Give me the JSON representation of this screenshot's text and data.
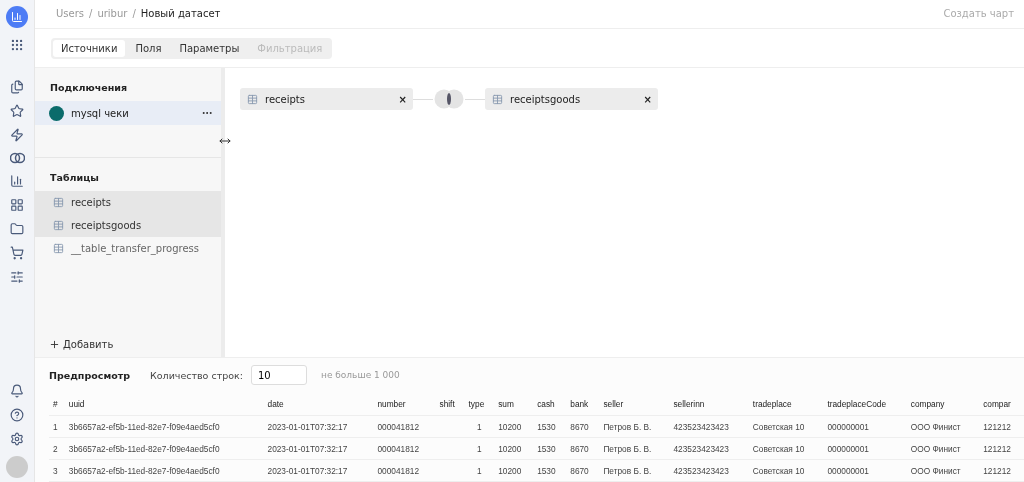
{
  "breadcrumbs": [
    "Users",
    "uribur",
    "Новый датасет"
  ],
  "breadcrumb_separator": "/",
  "header_action": "Создать чарт",
  "tabs": [
    {
      "label": "Источники",
      "selected": true,
      "disabled": false
    },
    {
      "label": "Поля",
      "selected": false,
      "disabled": false
    },
    {
      "label": "Параметры",
      "selected": false,
      "disabled": false
    },
    {
      "label": "Фильтрация",
      "selected": false,
      "disabled": true
    }
  ],
  "connections": {
    "title": "Подключения",
    "items": [
      {
        "label": "mysql чеки",
        "selected": true
      }
    ]
  },
  "tables": {
    "title": "Таблицы",
    "items": [
      {
        "label": "receipts",
        "selected": true
      },
      {
        "label": "receiptsgoods",
        "selected": true
      },
      {
        "label": "__table_transfer_progress",
        "selected": false
      }
    ]
  },
  "add_button": "Добавить",
  "canvas": {
    "sources": [
      {
        "label": "receipts",
        "close": "×"
      },
      {
        "label": "receiptsgoods",
        "close": "×"
      }
    ]
  },
  "preview": {
    "title": "Предпросмотр",
    "rows_label": "Количество строк:",
    "rows_value": "10",
    "rows_hint": "не больше 1 000",
    "columns": [
      "#",
      "uuid",
      "date",
      "number",
      "shift",
      "type",
      "sum",
      "cash",
      "bank",
      "seller",
      "sellerinn",
      "tradeplace",
      "tradeplaceCode",
      "company",
      "compar"
    ],
    "rows": [
      [
        "1",
        "3b6657a2-ef5b-11ed-82e7-f09e4aed5cf0",
        "2023-01-01T07:32:17",
        "000041812",
        "",
        "1",
        "10200",
        "1530",
        "8670",
        "Петров Б. В.",
        "423523423423",
        "Советская 10",
        "000000001",
        "ООО Финист",
        "121212"
      ],
      [
        "2",
        "3b6657a2-ef5b-11ed-82e7-f09e4aed5cf0",
        "2023-01-01T07:32:17",
        "000041812",
        "",
        "1",
        "10200",
        "1530",
        "8670",
        "Петров Б. В.",
        "423523423423",
        "Советская 10",
        "000000001",
        "ООО Финист",
        "121212"
      ],
      [
        "3",
        "3b6657a2-ef5b-11ed-82e7-f09e4aed5cf0",
        "2023-01-01T07:32:17",
        "000041812",
        "",
        "1",
        "10200",
        "1530",
        "8670",
        "Петров Б. В.",
        "423523423423",
        "Советская 10",
        "000000001",
        "ООО Финист",
        "121212"
      ]
    ]
  }
}
